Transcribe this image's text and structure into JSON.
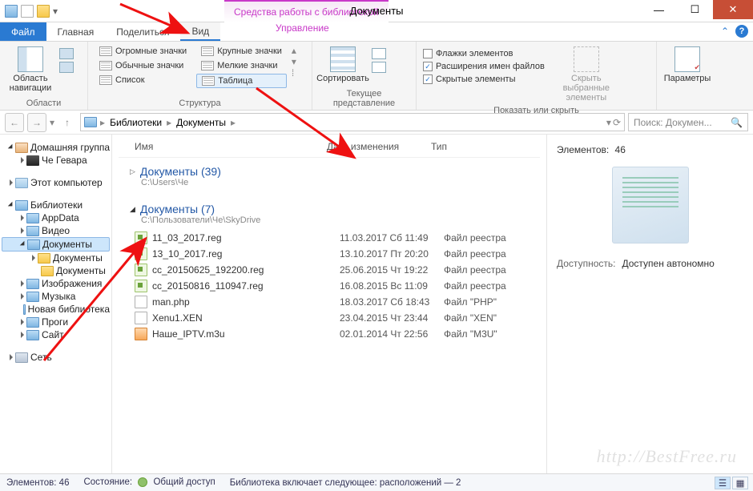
{
  "window": {
    "title": "Документы",
    "library_tools_label": "Средства работы с библиотекой"
  },
  "tabs": {
    "file": "Файл",
    "home": "Главная",
    "share": "Поделиться",
    "view": "Вид",
    "manage": "Управление"
  },
  "ribbon": {
    "nav_pane": "Область навигации",
    "panels_group": "Области",
    "layout": {
      "huge": "Огромные значки",
      "large": "Крупные значки",
      "normal": "Обычные значки",
      "small": "Мелкие значки",
      "list": "Список",
      "table": "Таблица"
    },
    "layout_group": "Структура",
    "sort": "Сортировать",
    "current_view_group": "Текущее представление",
    "checks": {
      "item_checkboxes": "Флажки элементов",
      "file_ext": "Расширения имен файлов",
      "hidden": "Скрытые элементы"
    },
    "hide_selected": "Скрыть выбранные элементы",
    "show_hide_group": "Показать или скрыть",
    "options": "Параметры"
  },
  "addressbar": {
    "libraries": "Библиотеки",
    "documents": "Документы"
  },
  "search": {
    "placeholder": "Поиск: Докумен..."
  },
  "tree": {
    "homegroup": "Домашняя группа",
    "che": "Че Гевара",
    "this_pc": "Этот компьютер",
    "libraries": "Библиотеки",
    "appdata": "AppData",
    "video": "Видео",
    "documents": "Документы",
    "documents_sub1": "Документы",
    "documents_sub2": "Документы",
    "images": "Изображения",
    "music": "Музыка",
    "new_lib": "Новая библиотека",
    "progi": "Проги",
    "site": "Сайт",
    "network": "Сеть"
  },
  "columns": {
    "name": "Имя",
    "date": "Дата изменения",
    "type": "Тип"
  },
  "groups": [
    {
      "title": "Документы (39)",
      "path": "C:\\Users\\Че"
    },
    {
      "title": "Документы (7)",
      "path": "C:\\Пользователи\\Че\\SkyDrive"
    }
  ],
  "files": [
    {
      "icon": "reg",
      "name": "11_03_2017.reg",
      "date": "11.03.2017 Сб 11:49",
      "type": "Файл реестра"
    },
    {
      "icon": "reg",
      "name": "13_10_2017.reg",
      "date": "13.10.2017 Пт 20:20",
      "type": "Файл реестра"
    },
    {
      "icon": "reg",
      "name": "cc_20150625_192200.reg",
      "date": "25.06.2015 Чт 19:22",
      "type": "Файл реестра"
    },
    {
      "icon": "reg",
      "name": "cc_20150816_110947.reg",
      "date": "16.08.2015 Вс 11:09",
      "type": "Файл реестра"
    },
    {
      "icon": "php",
      "name": "man.php",
      "date": "18.03.2017 Сб 18:43",
      "type": "Файл \"PHP\""
    },
    {
      "icon": "xen",
      "name": "Xenu1.XEN",
      "date": "23.04.2015 Чт 23:44",
      "type": "Файл \"XEN\""
    },
    {
      "icon": "m3u",
      "name": "Наше_IPTV.m3u",
      "date": "02.01.2014 Чт 22:56",
      "type": "Файл \"M3U\""
    }
  ],
  "preview": {
    "count_label": "Элементов:",
    "count": "46",
    "availability_label": "Доступность:",
    "availability_value": "Доступен автономно"
  },
  "status": {
    "elements": "Элементов: 46",
    "state": "Состояние:",
    "shared": "Общий доступ",
    "lib_includes": "Библиотека включает следующее: расположений — 2"
  },
  "watermark": "http://BestFree.ru"
}
